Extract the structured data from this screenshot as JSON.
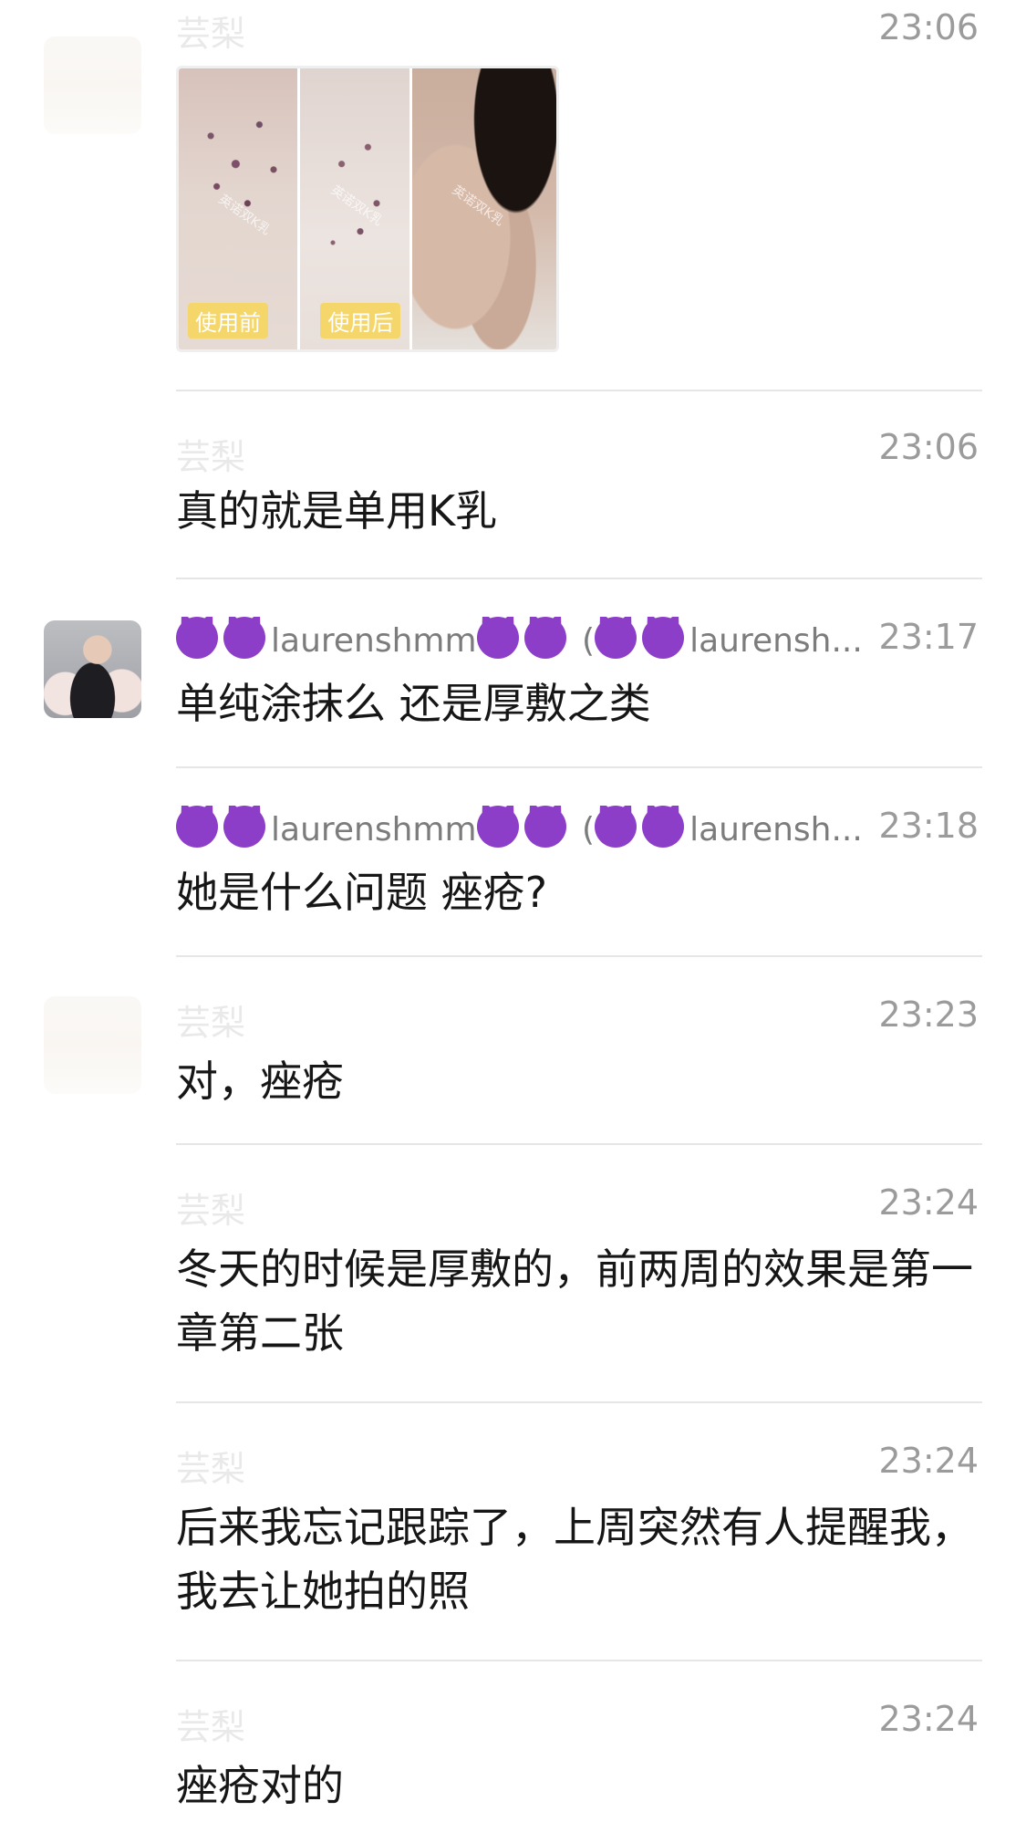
{
  "messages": [
    {
      "sender": "芸梨",
      "time": "23:06",
      "type": "image",
      "labels": {
        "before": "使用前",
        "after": "使用后"
      },
      "watermark": "英诺双K乳"
    },
    {
      "sender": "芸梨",
      "time": "23:06",
      "text": "真的就是单用K乳"
    },
    {
      "sender": "laurenshmm",
      "sender_suffix_open": "(",
      "sender_suffix": "laurensh...",
      "time": "23:17",
      "text": "单纯涂抹么 还是厚敷之类"
    },
    {
      "sender": "laurenshmm",
      "sender_suffix_open": "(",
      "sender_suffix": "laurensh...",
      "time": "23:18",
      "text": "她是什么问题 痤疮?"
    },
    {
      "sender": "芸梨",
      "time": "23:23",
      "text": "对，痤疮"
    },
    {
      "sender": "芸梨",
      "time": "23:24",
      "text": "冬天的时候是厚敷的，前两周的效果是第一章第二张"
    },
    {
      "sender": "芸梨",
      "time": "23:24",
      "text": "后来我忘记跟踪了，上周突然有人提醒我，我去让她拍的照"
    },
    {
      "sender": "芸梨",
      "time": "23:24",
      "text": "痤疮对的"
    }
  ]
}
